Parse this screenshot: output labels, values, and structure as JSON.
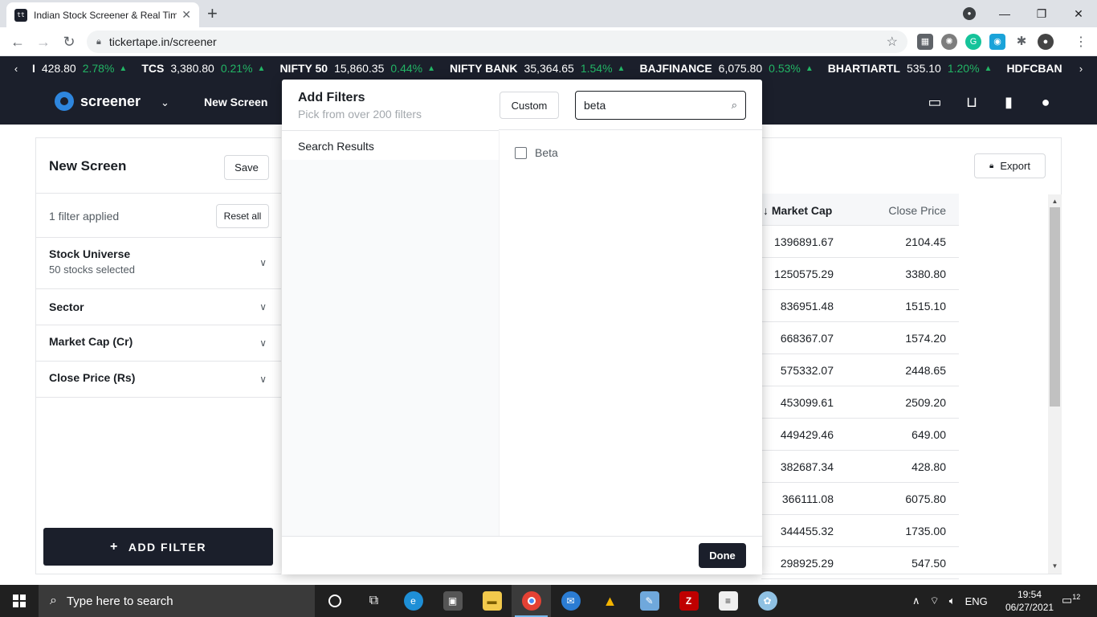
{
  "browser": {
    "tab_title": "Indian Stock Screener & Real Tim",
    "tab_favicon": "tickertape-icon",
    "url": "tickertape.in/screener",
    "new_tab": "+",
    "window_controls": {
      "minimize": "—",
      "maximize": "❐",
      "close": "✕"
    }
  },
  "ticker": {
    "items": [
      {
        "name": "I",
        "price": "428.80",
        "change": "2.78%"
      },
      {
        "name": "TCS",
        "price": "3,380.80",
        "change": "0.21%"
      },
      {
        "name": "NIFTY 50",
        "price": "15,860.35",
        "change": "0.44%"
      },
      {
        "name": "NIFTY BANK",
        "price": "35,364.65",
        "change": "1.54%"
      },
      {
        "name": "BAJFINANCE",
        "price": "6,075.80",
        "change": "0.53%"
      },
      {
        "name": "BHARTIARTL",
        "price": "535.10",
        "change": "1.20%"
      },
      {
        "name": "HDFCBAN",
        "price": "",
        "change": ""
      }
    ],
    "up_color": "#22b565"
  },
  "appbar": {
    "logo_text": "screener",
    "nav_new_screen": "New Screen"
  },
  "left_panel": {
    "title": "New Screen",
    "save_label": "Save",
    "filters_applied": "1 filter applied",
    "reset_label": "Reset all",
    "filters": [
      {
        "name": "Stock Universe",
        "sub": "50 stocks selected"
      },
      {
        "name": "Sector",
        "sub": ""
      },
      {
        "name": "Market Cap (Cr)",
        "sub": ""
      },
      {
        "name": "Close Price (Rs)",
        "sub": ""
      }
    ],
    "add_filter_label": "ADD FILTER"
  },
  "table": {
    "export_label": "Export",
    "col_market_cap": "↓ Market Cap",
    "col_close_price": "Close Price",
    "rows": [
      {
        "mcap": "1396891.67",
        "close": "2104.45"
      },
      {
        "mcap": "1250575.29",
        "close": "3380.80"
      },
      {
        "mcap": "836951.48",
        "close": "1515.10"
      },
      {
        "mcap": "668367.07",
        "close": "1574.20"
      },
      {
        "mcap": "575332.07",
        "close": "2448.65"
      },
      {
        "mcap": "453099.61",
        "close": "2509.20"
      },
      {
        "mcap": "449429.46",
        "close": "649.00"
      },
      {
        "mcap": "382687.34",
        "close": "428.80"
      },
      {
        "mcap": "366111.08",
        "close": "6075.80"
      },
      {
        "mcap": "344455.32",
        "close": "1735.00"
      },
      {
        "mcap": "298925.29",
        "close": "547.50"
      }
    ]
  },
  "modal": {
    "title": "Add Filters",
    "subtitle": "Pick from over 200 filters",
    "custom_label": "Custom",
    "search_value": "beta",
    "section_label": "Search Results",
    "results": [
      {
        "label": "Beta",
        "checked": false
      }
    ],
    "done_label": "Done"
  },
  "taskbar": {
    "search_placeholder": "Type here to search",
    "language": "ENG",
    "time": "19:54",
    "date": "06/27/2021",
    "notifications": "12"
  }
}
